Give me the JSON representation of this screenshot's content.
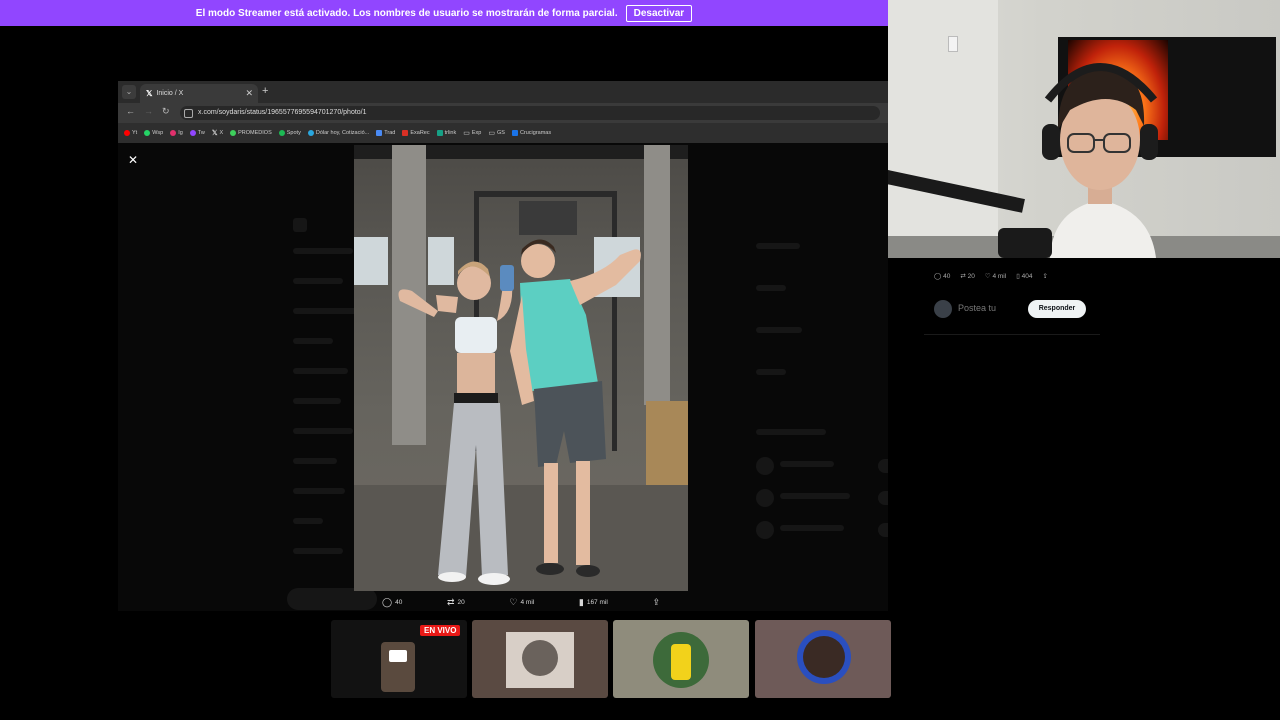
{
  "banner": {
    "message": "El modo Streamer está activado. Los nombres de usuario se mostrarán de forma parcial.",
    "button": "Desactivar"
  },
  "browser": {
    "tab_title": "Inicio / X",
    "url": "x.com/soydaris/status/1965577695594701270/photo/1",
    "bookmarks": [
      {
        "label": "Yt",
        "color": "#ff0000"
      },
      {
        "label": "Wsp",
        "color": "#25d366"
      },
      {
        "label": "Ig",
        "color": "#e1306c"
      },
      {
        "label": "Tw",
        "color": "#9146ff"
      },
      {
        "label": "X",
        "color": "#ffffff"
      },
      {
        "label": "PROMEDIOS",
        "color": "#3ecf5c"
      },
      {
        "label": "Spoty",
        "color": "#1db954"
      },
      {
        "label": "Dólar hoy, Cotizació...",
        "color": "#2aa7df"
      },
      {
        "label": "Trad",
        "color": "#4a8af4"
      },
      {
        "label": "ExaRec",
        "color": "#d93025"
      },
      {
        "label": "trlink",
        "color": "#16a085"
      },
      {
        "label": "Exp",
        "color": "#888888"
      },
      {
        "label": "GS",
        "color": "#888888"
      },
      {
        "label": "Crucigramas",
        "color": "#1a73e8"
      }
    ]
  },
  "photo_actions": {
    "replies": "40",
    "reposts": "20",
    "likes": "4 mil",
    "views": "167 mil"
  },
  "sidebar_actions": {
    "replies": "40",
    "reposts": "20",
    "likes": "4 mil",
    "bookmarks": "404"
  },
  "reply": {
    "placeholder": "Postea tu",
    "button": "Responder"
  },
  "stream": {
    "live_badge": "EN VIVO"
  }
}
